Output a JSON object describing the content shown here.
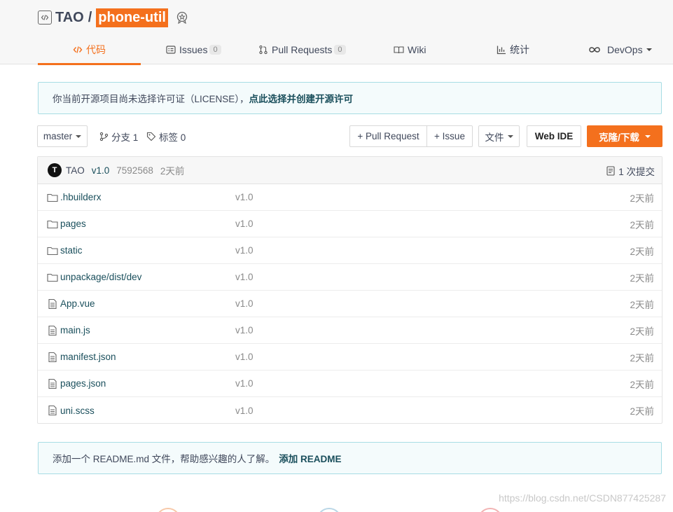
{
  "repo": {
    "owner": "TAO",
    "separator": "/",
    "name": "phone-util"
  },
  "tabs": [
    {
      "label": "代码",
      "icon": "code-icon"
    },
    {
      "label": "Issues",
      "count": "0",
      "icon": "issues-icon"
    },
    {
      "label": "Pull Requests",
      "count": "0",
      "icon": "pull-request-icon"
    },
    {
      "label": "Wiki",
      "icon": "wiki-icon"
    },
    {
      "label": "统计",
      "icon": "stats-icon"
    },
    {
      "label": "DevOps",
      "icon": "devops-icon"
    }
  ],
  "license_notice": {
    "text": "你当前开源项目尚未选择许可证（LICENSE），",
    "link": "点此选择并创建开源许可"
  },
  "toolbar": {
    "branch": "master",
    "branches_label": "分支 1",
    "tags_label": "标签 0",
    "pull_request": "+ Pull Request",
    "issue": "+ Issue",
    "file": "文件",
    "web_ide": "Web IDE",
    "clone": "克隆/下载"
  },
  "commit": {
    "avatar_letter": "T",
    "author": "TAO",
    "message": "v1.0",
    "sha": "7592568",
    "time": "2天前",
    "count_label": "1 次提交"
  },
  "files": [
    {
      "name": ".hbuilderx",
      "type": "folder",
      "message": "v1.0",
      "time": "2天前"
    },
    {
      "name": "pages",
      "type": "folder",
      "message": "v1.0",
      "time": "2天前"
    },
    {
      "name": "static",
      "type": "folder",
      "message": "v1.0",
      "time": "2天前"
    },
    {
      "name": "unpackage/dist/dev",
      "type": "folder",
      "message": "v1.0",
      "time": "2天前"
    },
    {
      "name": "App.vue",
      "type": "file",
      "message": "v1.0",
      "time": "2天前"
    },
    {
      "name": "main.js",
      "type": "file",
      "message": "v1.0",
      "time": "2天前"
    },
    {
      "name": "manifest.json",
      "type": "file",
      "message": "v1.0",
      "time": "2天前"
    },
    {
      "name": "pages.json",
      "type": "file",
      "message": "v1.0",
      "time": "2天前"
    },
    {
      "name": "uni.scss",
      "type": "file",
      "message": "v1.0",
      "time": "2天前"
    }
  ],
  "readme_notice": {
    "text": "添加一个 README.md 文件，帮助感兴趣的人了解。",
    "link": "添加 README"
  },
  "watermark": "https://blog.csdn.net/CSDN877425287",
  "colors": {
    "accent": "#f4701d",
    "link": "#1a4f5c",
    "notice_border": "#a7dde4"
  }
}
